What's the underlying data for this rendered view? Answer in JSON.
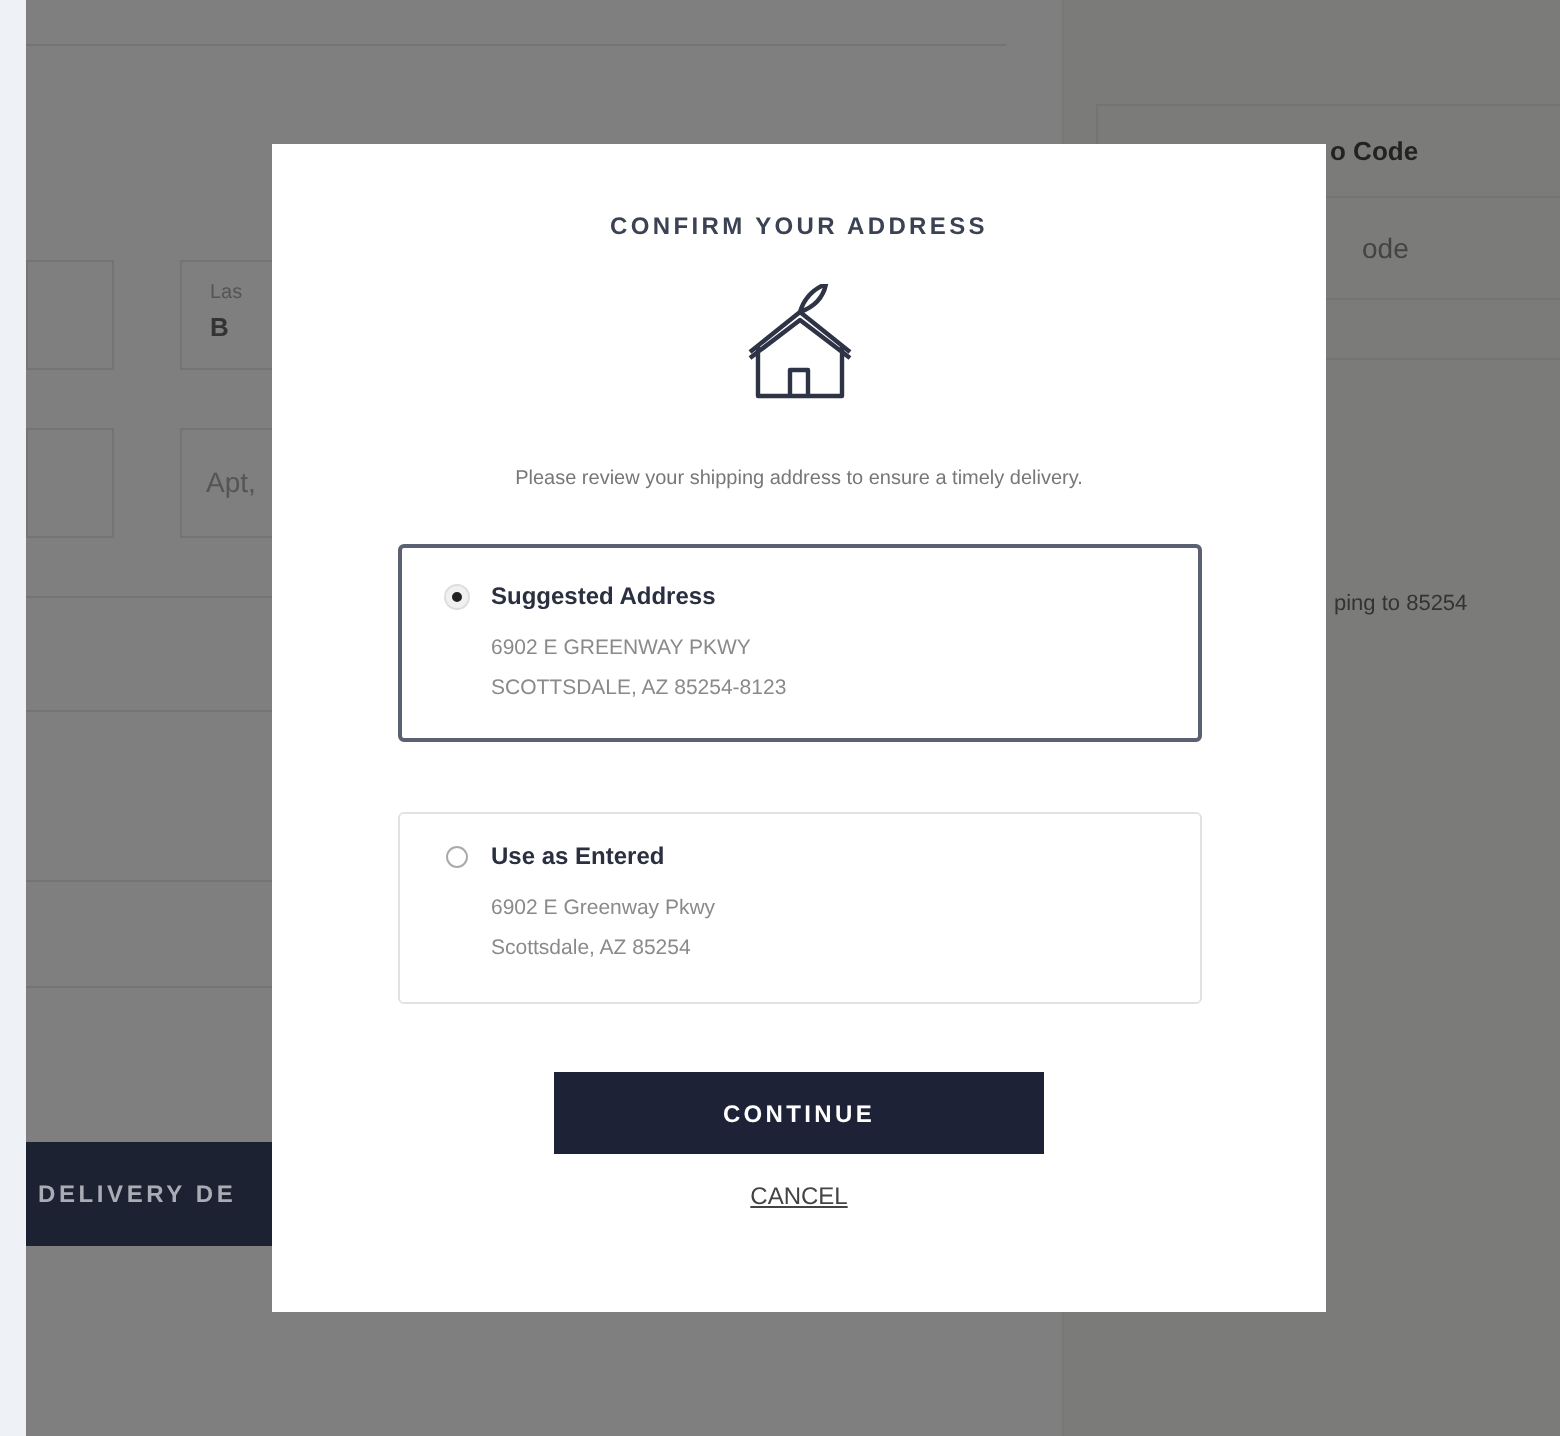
{
  "background_form": {
    "last_name_label": "Las",
    "last_name_value": "B",
    "apt_placeholder": "Apt,",
    "delivery_button": "DELIVERY DE"
  },
  "promo": {
    "heading": "o Code",
    "placeholder": "ode",
    "shipping_note": "ping to 85254"
  },
  "dialog": {
    "title": "CONFIRM YOUR ADDRESS",
    "message": "Please review your shipping address to ensure a timely delivery.",
    "options": [
      {
        "label": "Suggested Address",
        "line_1": "6902 E GREENWAY PKWY",
        "line_2": "SCOTTSDALE, AZ 85254-8123",
        "selected": true
      },
      {
        "label": "Use as Entered",
        "line_1": "6902 E Greenway Pkwy",
        "line_2": "Scottsdale, AZ 85254",
        "selected": false
      }
    ],
    "continue_button": "CONTINUE",
    "cancel_link": "CANCEL"
  }
}
